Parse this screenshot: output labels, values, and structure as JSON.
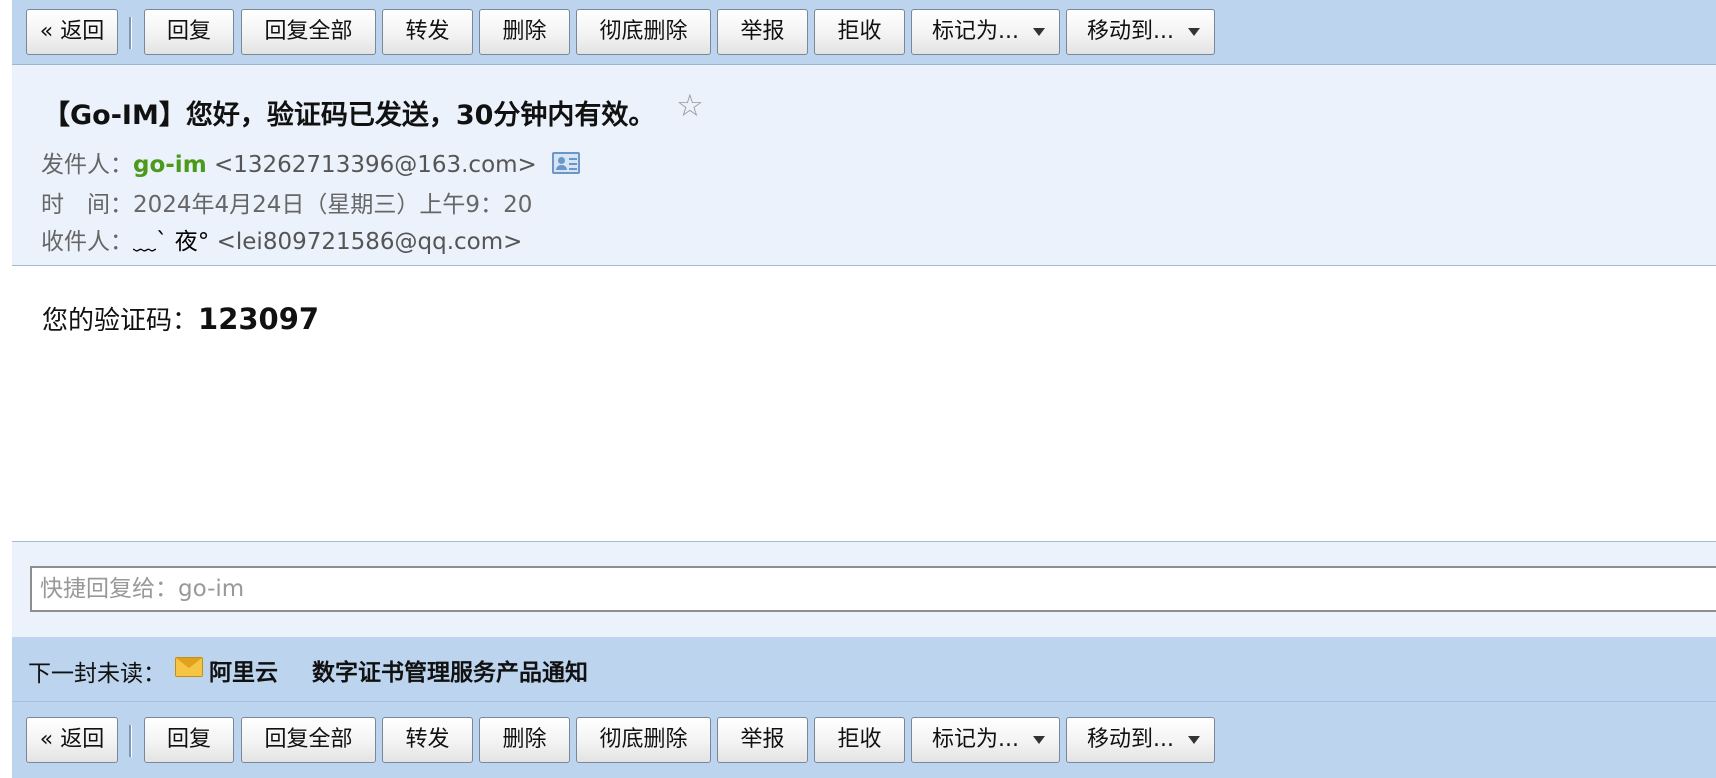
{
  "toolbar": {
    "back": "« 返回",
    "reply": "回复",
    "reply_all": "回复全部",
    "forward": "转发",
    "delete": "删除",
    "delete_permanently": "彻底删除",
    "report": "举报",
    "reject": "拒收",
    "mark_as": "标记为...",
    "move_to": "移动到..."
  },
  "message": {
    "subject": "【Go-IM】您好，验证码已发送，30分钟内有效。",
    "star": "☆",
    "from_label": "发件人：",
    "from_name": "go-im",
    "from_email": "<13262713396@163.com>",
    "time_label": "时　间：",
    "time_value": "2024年4月24日（星期三）上午9：20",
    "to_label": "收件人：",
    "to_name": "﹏ˋ 夜°",
    "to_email": "<lei809721586@qq.com>",
    "body_label": "您的验证码：",
    "body_code": "123097"
  },
  "quick_reply": {
    "placeholder": "快捷回复给：go-im"
  },
  "next_unread": {
    "label": "下一封未读：",
    "sender": "阿里云",
    "subject": "数字证书管理服务产品通知"
  }
}
